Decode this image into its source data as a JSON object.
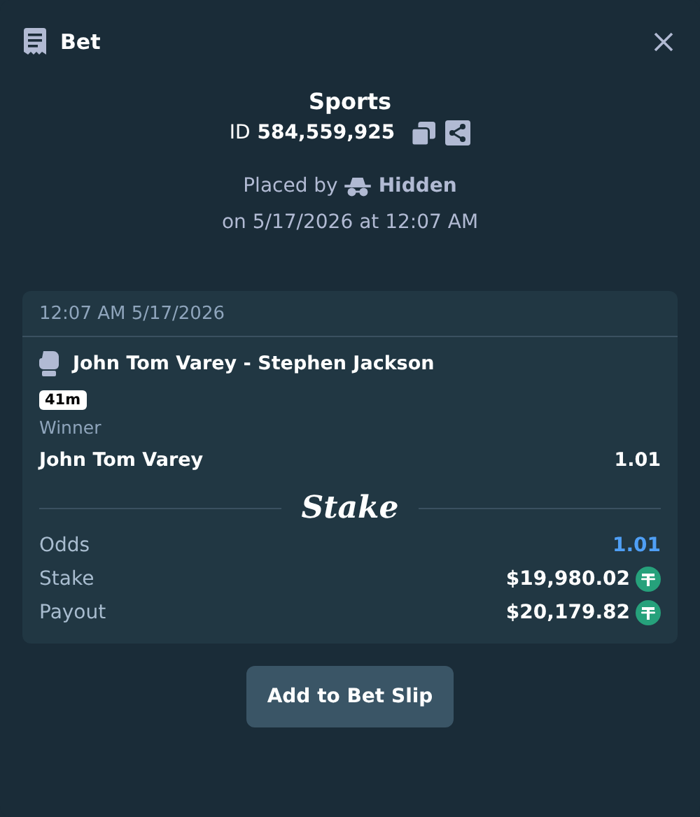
{
  "header": {
    "title": "Bet"
  },
  "summary": {
    "category": "Sports",
    "id_label": "ID",
    "id_value": "584,559,925",
    "placed_by_label": "Placed by",
    "placed_by_user": "Hidden",
    "placed_on": "on 5/17/2026 at 12:07 AM"
  },
  "bet": {
    "timestamp": "12:07 AM 5/17/2026",
    "event": "John Tom Varey - Stephen Jackson",
    "live_badge": "41m",
    "market": "Winner",
    "selection": "John Tom Varey",
    "selection_odds": "1.01",
    "logo": "Stake",
    "totals": [
      {
        "kind": "odds",
        "label": "Odds",
        "value": "1.01"
      },
      {
        "kind": "currency",
        "label": "Stake",
        "value": "$19,980.02"
      },
      {
        "kind": "currency",
        "label": "Payout",
        "value": "$20,179.82"
      }
    ]
  },
  "actions": [
    "Add to Bet Slip"
  ]
}
